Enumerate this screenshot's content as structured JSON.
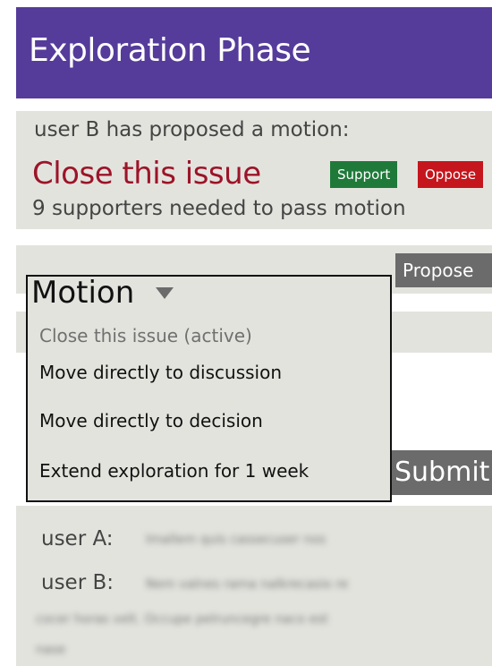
{
  "header": {
    "title": "Exploration Phase"
  },
  "motion": {
    "proposer_text": "user B has proposed a motion:",
    "title": "Close this issue",
    "support_label": "Support",
    "oppose_label": "Oppose",
    "needed_text": "9 supporters needed to pass motion"
  },
  "propose": {
    "dropdown_label": "Motion",
    "propose_label": "Propose",
    "options": [
      {
        "label": "Close this issue (active)",
        "active": true
      },
      {
        "label": "Move directly to discussion",
        "active": false
      },
      {
        "label": "Move directly to decision",
        "active": false
      },
      {
        "label": "Extend exploration for 1 week",
        "active": false
      }
    ]
  },
  "composer": {
    "submit_label": "Submit"
  },
  "comments": [
    {
      "author": "user A:",
      "text": "Imallem quis cassecuser nos"
    },
    {
      "author": "user B:",
      "text_lines": [
        "Nem valnes rama nalkrecasio re",
        "cocer horas velt. Occupe pelruncegre naco est",
        "nase"
      ]
    }
  ]
}
